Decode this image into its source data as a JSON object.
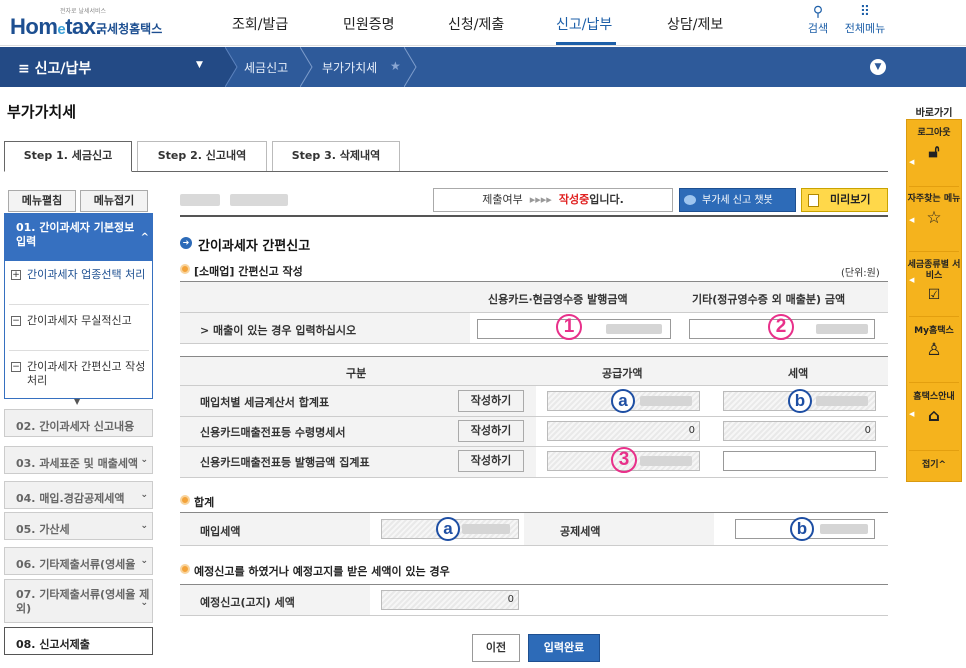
{
  "header": {
    "logo_small": "전자로 날세서비스",
    "logo_main": "Hom",
    "logo_e": "e",
    "logo_tax": "tax.",
    "logo_kr": "국세청홈택스",
    "menu": [
      "조회/발급",
      "민원증명",
      "신청/제출",
      "신고/납부",
      "상담/제보"
    ],
    "active_menu": "신고/납부",
    "search_label": "검색",
    "all_menu_label": "전체메뉴"
  },
  "navbar": {
    "menu_label": "≡  신고/납부",
    "crumbs": [
      "세금신고",
      "부가가치세"
    ]
  },
  "page_title": "부가가치세",
  "tabs": [
    "Step 1. 세금신고",
    "Step 2. 신고내역",
    "Step 3. 삭제내역"
  ],
  "left_menu": {
    "expand_all": "메뉴펼침",
    "collapse_all": "메뉴접기",
    "active": "01. 간이과세자 기본정보 입력",
    "sub_items": [
      "간이과세자 업종선택 처리",
      "간이과세자 무실적신고",
      "간이과세자 간편신고 작성 처리"
    ],
    "items": [
      "02. 간이과세자 신고내용",
      "03. 과세표준 및 매출세액",
      "04. 매입.경감공제세액",
      "05. 가산세",
      "06. 기타제출서류(영세율",
      "07. 기타제출서류(영세율 제외)",
      "08. 신고서제출"
    ]
  },
  "status": {
    "label": "제출여부",
    "arrows": "▸▸▸▸",
    "state": "작성중",
    "state_suffix": "입니다.",
    "chatbot": "부가세 신고 챗봇",
    "preview": "미리보기"
  },
  "section": {
    "title": "간이과세자 간편신고",
    "sub1": "[소매업] 간편신고 작성",
    "unit": "(단위:원)",
    "col_card": "신용카드·현금영수증 발행금액",
    "col_other": "기타(정규영수증 외 매출분) 금액",
    "sales_row": "> 매출이 있는 경우 입력하십시오",
    "col_div": "구분",
    "col_supply": "공급가액",
    "col_tax": "세액",
    "rows": [
      {
        "label": "매입처별 세금계산서 합계표",
        "btn": "작성하기",
        "supply": "",
        "tax": ""
      },
      {
        "label": "신용카드매출전표등 수령명세서",
        "btn": "작성하기",
        "supply": "0",
        "tax": "0"
      },
      {
        "label": "신용카드매출전표등 발행금액 집계표",
        "btn": "작성하기",
        "supply": "",
        "tax": ""
      }
    ],
    "total_title": "합계",
    "purchase_tax": "매입세액",
    "deduct_tax": "공제세액",
    "pre_title": "예정신고를 하였거나 예정고지를 받은 세액이 있는 경우",
    "pre_label": "예정신고(고지) 세액",
    "pre_value": "0",
    "markers": {
      "one": "1",
      "two": "2",
      "three": "3",
      "a": "a",
      "b": "b"
    }
  },
  "buttons": {
    "prev": "이전",
    "done": "입력완료"
  },
  "quick": {
    "title": "바로가기",
    "items": [
      "로그아웃",
      "자주찾는 메뉴",
      "세금종류별 서비스",
      "My홈택스",
      "홈택스안내"
    ],
    "fold": "접기^"
  },
  "colors": {
    "primary": "#2e5a9a",
    "accent_blue": "#1d5fa8",
    "highlight": "#e8308a",
    "quick_bg": "#f5b31d"
  }
}
